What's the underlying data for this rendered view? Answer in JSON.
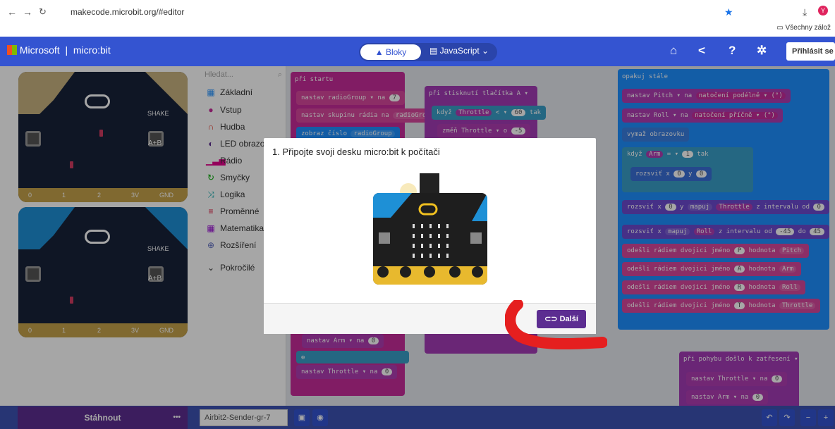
{
  "browser": {
    "url": "makecode.microbit.org/#editor",
    "bookmarks_label": "Všechny zálož"
  },
  "header": {
    "microsoft": "Microsoft",
    "microbit": "micro:bit",
    "blocks_tab": "Bloky",
    "js_tab": "JavaScript",
    "login": "Přihlásit se"
  },
  "simulator": {
    "shake": "SHAKE",
    "ab": "A+B",
    "pins": [
      "0",
      "1",
      "2",
      "3V",
      "GND"
    ]
  },
  "toolbox": {
    "search_placeholder": "Hledat...",
    "categories": [
      "Základní",
      "Vstup",
      "Hudba",
      "LED obrazo",
      "Rádio",
      "Smyčky",
      "Logika",
      "Proměnné",
      "Matematika",
      "Rozšíření",
      "Pokročilé"
    ],
    "colors": [
      "#1e90ff",
      "#c72c9a",
      "#e63022",
      "#5c2d91",
      "#e3008c",
      "#00aa00",
      "#00a4a6",
      "#dc143c",
      "#9400d3",
      "#5c6bc0",
      "#333333"
    ]
  },
  "blocks": {
    "on_start": "při startu",
    "set_radio_group": "nastav radioGroup",
    "to": "na",
    "val7": "7",
    "set_radio_group_name": "nastav skupinu rádia na",
    "radio_group_var": "radioGroup",
    "show_number": "zobraz číslo",
    "on_button": "při stisknutí tlačítka A",
    "if": "když",
    "throttle": "Throttle",
    "lt": "<",
    "val60": "60",
    "then": "tak",
    "change_throttle": "změň Throttle",
    "by": "o",
    "valm5": "-5",
    "set_arm": "nastav Arm",
    "val0": "0",
    "set_throttle": "nastav Throttle",
    "forever": "opakuj stále",
    "set_pitch": "nastav Pitch",
    "rotation_pitch": "natočení podélně",
    "deg": "(°)",
    "set_roll": "nastav Roll",
    "rotation_roll": "natočení příčně",
    "clear_screen": "vymaž obrazovku",
    "arm": "Arm",
    "eq": "=",
    "val1": "1",
    "plot_x": "rozsviť x",
    "y": "y",
    "map": "mapuj",
    "from_range": "z intervalu od",
    "to_range": "do",
    "roll": "Roll",
    "valm45": "-45",
    "val45": "45",
    "send_pair": "odešli rádiem dvojici jméno",
    "value": "hodnota",
    "nP": "P",
    "nA": "A",
    "nR": "R",
    "nT": "T",
    "pitch": "Pitch",
    "on_shake": "při pohybu došlo k zatřesení"
  },
  "modal": {
    "title": "1. Připojte svoji desku micro:bit k počítači",
    "next": "Další"
  },
  "bottom": {
    "download": "Stáhnout",
    "more": "•••",
    "project_name": "Airbit2-Sender-gr-7"
  }
}
